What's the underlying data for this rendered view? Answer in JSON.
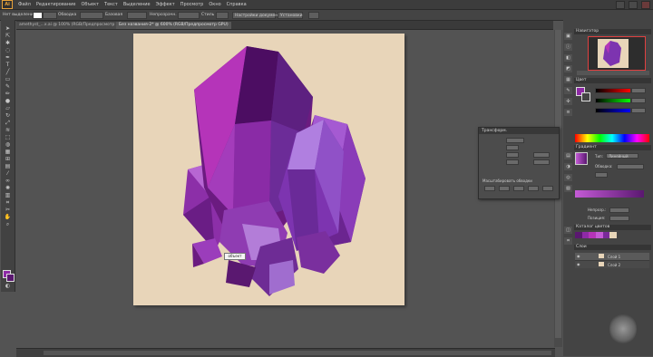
{
  "app": {
    "logo": "Ai"
  },
  "menu": [
    "Файл",
    "Редактирование",
    "Объект",
    "Текст",
    "Выделение",
    "Эффект",
    "Просмотр",
    "Окно",
    "Справка"
  ],
  "controlbar": {
    "selection": "Нет выделения",
    "stroke": "Обводка",
    "basic": "Базовая",
    "opacity": "Непрозрачн.",
    "style": "Стиль",
    "document_setup": "Настройки документа",
    "preferences": "Установки"
  },
  "tabs": [
    "amethyst_...x.ai @ 100% (RGB/Предпросмотр GPU)",
    "Без названия-2* @ 600% (RGB/Предпросмотр GPU)"
  ],
  "tooltip": "объект",
  "panels": {
    "navigator": "Навигатор",
    "color": "Цвет",
    "transform": "Трансформ.",
    "transform_options": "Масштабировать обводки",
    "swatches": "Образцы",
    "gradient": "Градиент",
    "gradient_type": "Тип:",
    "gradient_type_value": "Линейный",
    "gradient_stroke": "Обводка:",
    "opacity": "Непрозр.:",
    "location": "Позиция:",
    "color_groups": "Каталог цветов",
    "layers": "Слои",
    "layer1": "Слой 1",
    "layer2": "Слой 2"
  },
  "colors": {
    "accent": "#9b2fae",
    "artboard": "#e8d5b9",
    "crystal_dark": "#5a1870",
    "crystal_light": "#c45bd6"
  }
}
